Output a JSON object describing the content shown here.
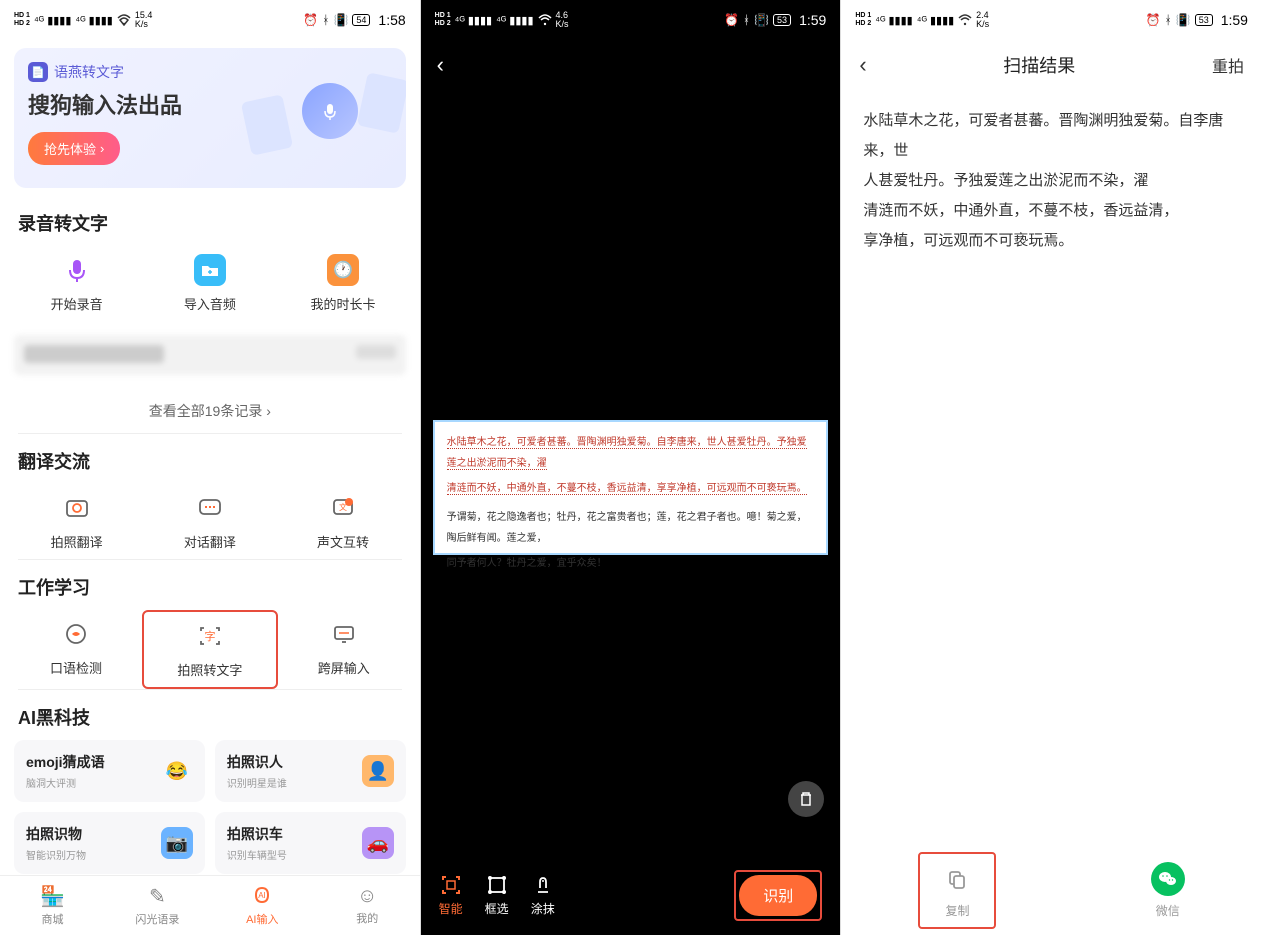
{
  "phone1": {
    "status": {
      "speed": "15.4",
      "speed_unit": "K/s",
      "battery": "54",
      "time": "1:58"
    },
    "banner": {
      "logo": "语燕转文字",
      "title": "搜狗输入法出品",
      "btn": "抢先体验"
    },
    "section1": {
      "title": "录音转文字",
      "items": [
        {
          "label": "开始录音",
          "icon": "mic",
          "color": "#a855f7"
        },
        {
          "label": "导入音频",
          "icon": "folder",
          "color": "#38bdf8"
        },
        {
          "label": "我的时长卡",
          "icon": "clock",
          "color": "#fb923c"
        }
      ]
    },
    "view_all": "查看全部19条记录",
    "section2": {
      "title": "翻译交流",
      "items": [
        {
          "label": "拍照翻译",
          "icon": "camera"
        },
        {
          "label": "对话翻译",
          "icon": "chat"
        },
        {
          "label": "声文互转",
          "icon": "swap"
        }
      ]
    },
    "section3": {
      "title": "工作学习",
      "items": [
        {
          "label": "口语检测",
          "icon": "speak"
        },
        {
          "label": "拍照转文字",
          "icon": "scan",
          "highlighted": true
        },
        {
          "label": "跨屏输入",
          "icon": "screen"
        }
      ]
    },
    "section4": {
      "title": "AI黑科技",
      "cards": [
        {
          "title": "emoji猜成语",
          "sub": "脑洞大评测",
          "icon": "😂",
          "bg": "#ffe599"
        },
        {
          "title": "拍照识人",
          "sub": "识别明星是谁",
          "icon": "👤",
          "bg": "#ffb86c"
        },
        {
          "title": "拍照识物",
          "sub": "智能识别万物",
          "icon": "📷",
          "bg": "#6bb3ff"
        },
        {
          "title": "拍照识车",
          "sub": "识别车辆型号",
          "icon": "🚗",
          "bg": "#b794f6"
        }
      ]
    },
    "tabs": [
      {
        "label": "商城",
        "icon": "shop"
      },
      {
        "label": "闪光语录",
        "icon": "quote"
      },
      {
        "label": "AI输入",
        "icon": "ai",
        "active": true
      },
      {
        "label": "我的",
        "icon": "user"
      }
    ]
  },
  "phone2": {
    "status": {
      "speed": "4.6",
      "speed_unit": "K/s",
      "battery": "53",
      "time": "1:59"
    },
    "doc_lines": [
      "水陆草木之花，可爱者甚蕃。晋陶渊明独爱菊。自李唐来，世人甚爱牡丹。予独爱莲之出淤泥而不染，濯",
      "清涟而不妖，中通外直，不蔓不枝，香远益清，享享净植，可远观而不可亵玩焉。",
      "予谓菊，花之隐逸者也；牡丹，花之富贵者也；莲，花之君子者也。噫！菊之爱，陶后鲜有闻。莲之爱，",
      "同予者何人？牡丹之爱，宜乎众矣！"
    ],
    "tools": [
      {
        "label": "智能",
        "active": true
      },
      {
        "label": "框选"
      },
      {
        "label": "涂抹"
      }
    ],
    "recognize": "识别"
  },
  "phone3": {
    "status": {
      "speed": "2.4",
      "speed_unit": "K/s",
      "battery": "53",
      "time": "1:59"
    },
    "header": {
      "title": "扫描结果",
      "action": "重拍"
    },
    "result": [
      "水陆草木之花，可爱者甚蕃。晋陶渊明独爱菊。自李唐来，世",
      "人甚爱牡丹。予独爱莲之出淤泥而不染，濯",
      "清涟而不妖，中通外直，不蔓不枝，香远益清，",
      "享净植，可远观而不可亵玩焉。"
    ],
    "actions": [
      {
        "label": "复制",
        "icon": "copy",
        "highlighted": true
      },
      {
        "label": "微信",
        "icon": "wechat"
      }
    ]
  }
}
